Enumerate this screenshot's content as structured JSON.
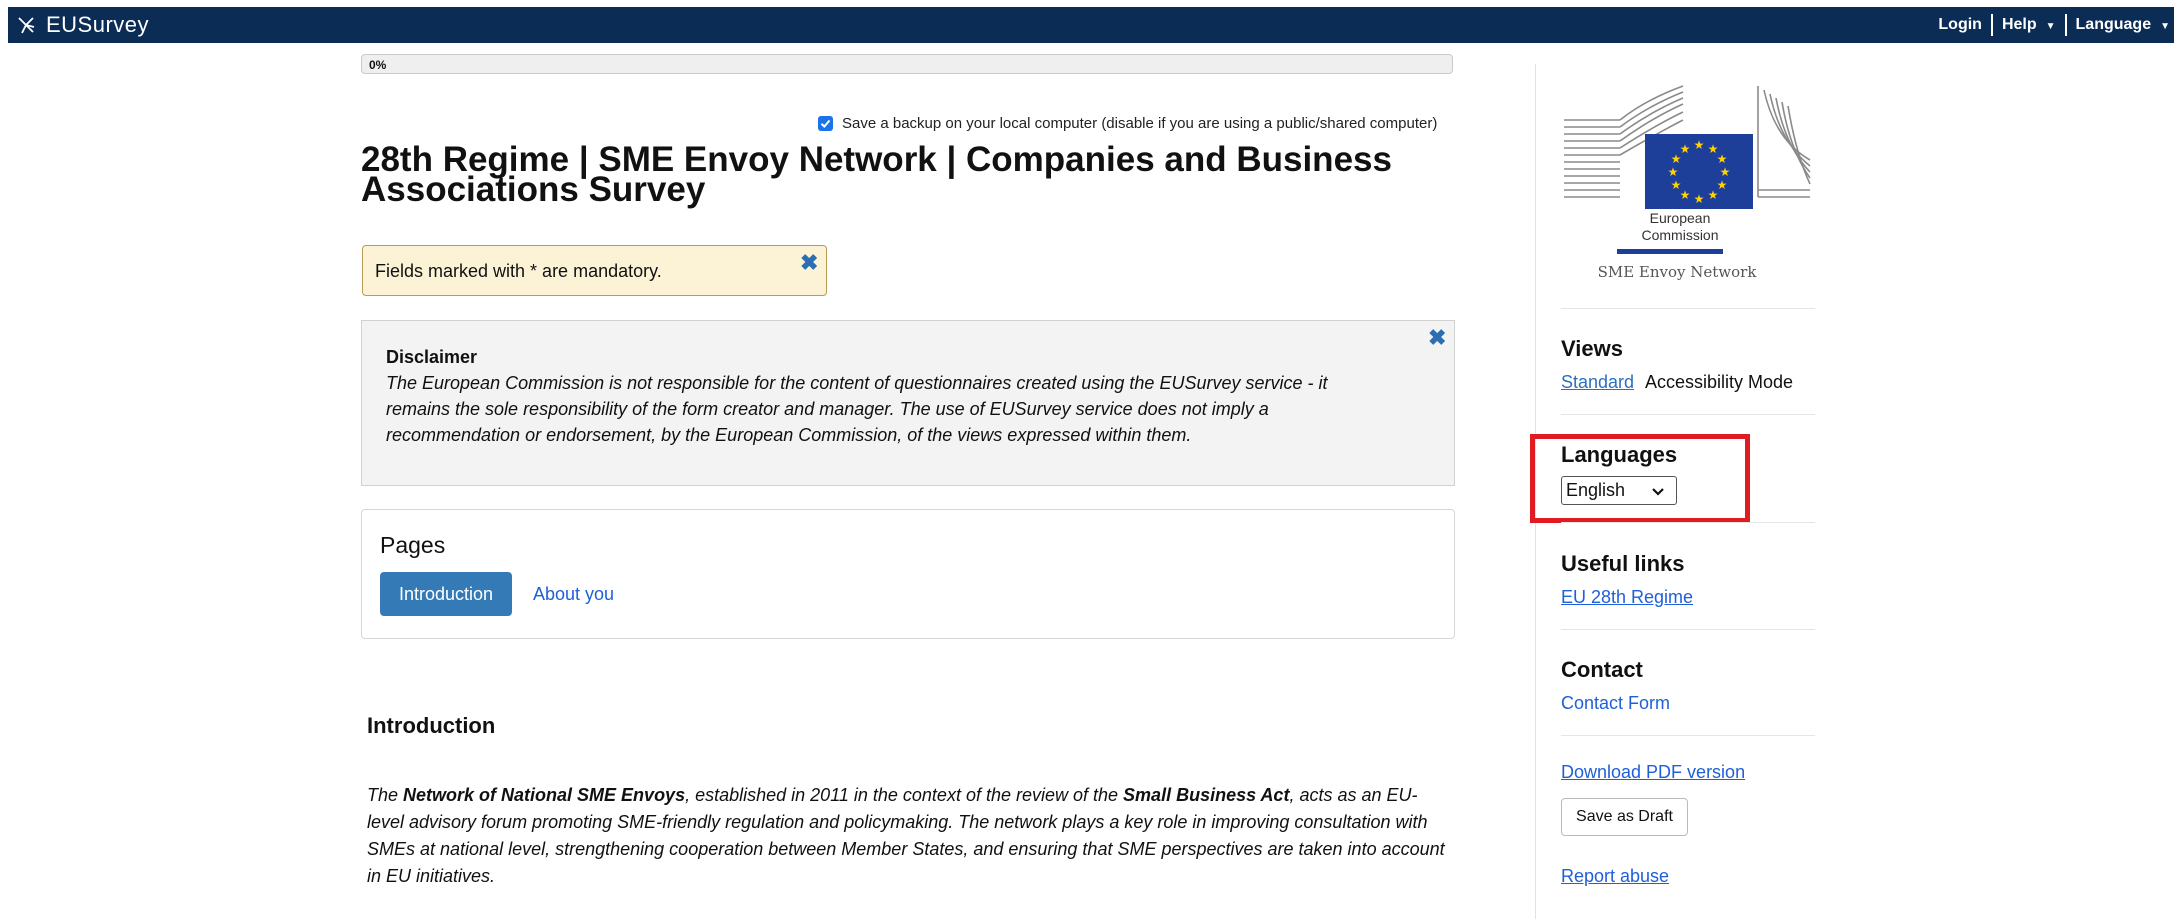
{
  "header": {
    "brand": "EUSurvey",
    "nav": {
      "login": "Login",
      "help": "Help",
      "language": "Language"
    }
  },
  "progress": {
    "text": "0%",
    "value": 0
  },
  "backup": {
    "label": "Save a backup on your local computer (disable if you are using a public/shared computer)",
    "checked": true
  },
  "survey": {
    "title": "28th Regime | SME Envoy Network | Companies and Business Associations Survey"
  },
  "mandatory_note": "Fields marked with * are mandatory.",
  "disclaimer": {
    "title": "Disclaimer",
    "body": "The European Commission is not responsible for the content of questionnaires created using the EUSurvey service - it remains the sole responsibility of the form creator and manager. The use of EUSurvey service does not imply a recommendation or endorsement, by the European Commission, of the views expressed within them."
  },
  "pages": {
    "title": "Pages",
    "items": [
      {
        "label": "Introduction",
        "active": true
      },
      {
        "label": "About you",
        "active": false
      }
    ]
  },
  "introduction": {
    "title": "Introduction",
    "p1_a": "The ",
    "p1_b": "Network of National SME Envoys",
    "p1_c": ", established in 2011 in the context of the review of the ",
    "p1_d": "Small Business Act",
    "p1_e": ", acts as an EU-level advisory forum promoting SME-friendly regulation and policymaking. The network plays a key role in improving consultation with SMEs at national level, strengthening cooperation between Member States, and ensuring that SME perspectives are taken into account in EU initiatives."
  },
  "logo": {
    "line1": "European",
    "line2": "Commission",
    "line3": "SME Envoy Network"
  },
  "sidebar": {
    "views": {
      "title": "Views",
      "standard": "Standard",
      "accessibility": "Accessibility Mode"
    },
    "languages": {
      "title": "Languages",
      "selected": "English"
    },
    "useful_links": {
      "title": "Useful links",
      "link": "EU 28th Regime"
    },
    "contact": {
      "title": "Contact",
      "link": "Contact Form"
    },
    "download_pdf": "Download PDF version",
    "save_draft": "Save as Draft",
    "report_abuse": "Report abuse"
  },
  "colors": {
    "header_bg": "#0b2c55",
    "primary": "#337ab7",
    "link": "#1f5fd8",
    "highlight": "#e01b22"
  }
}
